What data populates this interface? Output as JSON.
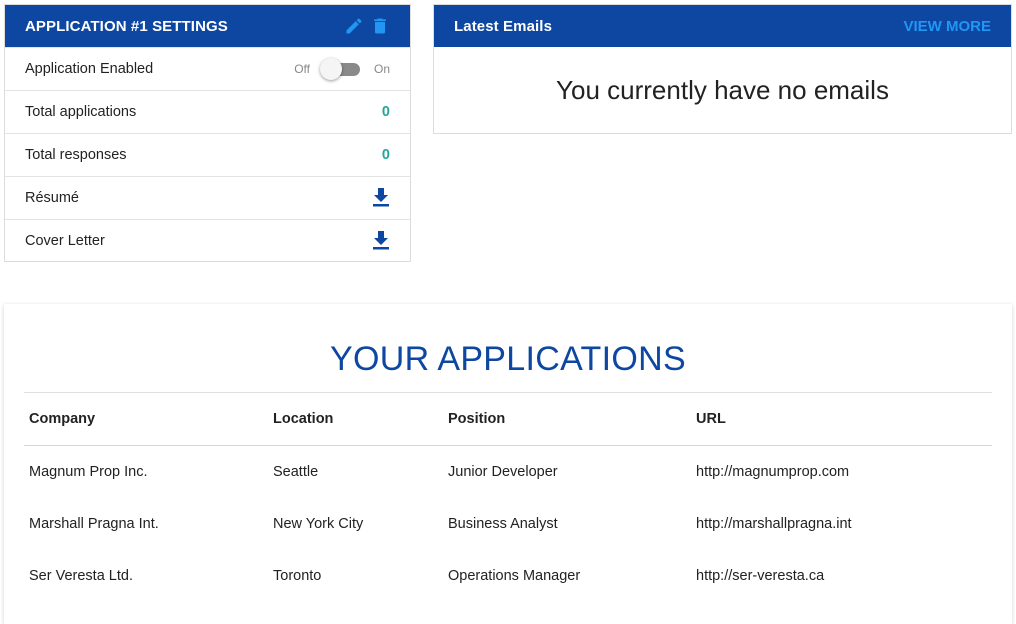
{
  "settings": {
    "title": "APPLICATION #1 SETTINGS",
    "rows": [
      {
        "label": "Application Enabled",
        "toggle_off": "Off",
        "toggle_on": "On"
      },
      {
        "label": "Total applications",
        "value": "0"
      },
      {
        "label": "Total responses",
        "value": "0"
      },
      {
        "label": "Résumé",
        "icon": "download-icon"
      },
      {
        "label": "Cover Letter",
        "icon": "download-icon"
      }
    ],
    "icons": [
      "edit-pencil-icon",
      "trash-icon"
    ]
  },
  "emails": {
    "title": "Latest Emails",
    "view_more": "VIEW MORE",
    "empty_message": "You currently have no emails"
  },
  "applications": {
    "title": "YOUR APPLICATIONS",
    "columns": [
      "Company",
      "Location",
      "Position",
      "URL"
    ],
    "rows": [
      [
        "Magnum Prop Inc.",
        "Seattle",
        "Junior Developer",
        "http://magnumprop.com"
      ],
      [
        "Marshall Pragna Int.",
        "New York City",
        "Business Analyst",
        "http://marshallpragna.int"
      ],
      [
        "Ser Veresta Ltd.",
        "Toronto",
        "Operations Manager",
        "http://ser-veresta.ca"
      ]
    ]
  },
  "colors": {
    "header_bg": "#0d47a1",
    "accent_teal": "#26a69a",
    "link_blue": "#2196f3"
  }
}
